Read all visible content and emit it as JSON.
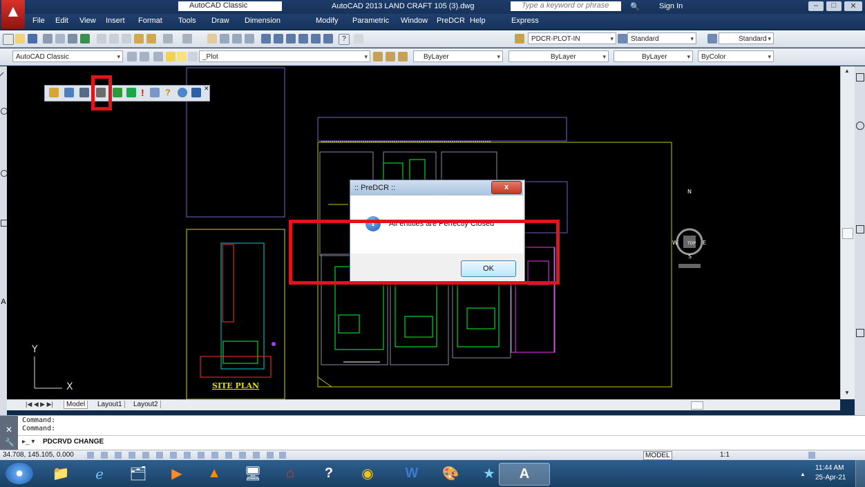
{
  "window": {
    "title": "AutoCAD 2013    LAND CRAFT 105 (3).dwg",
    "workspace": "AutoCAD Classic",
    "search_placeholder": "Type a keyword or phrase",
    "sign_in": "Sign In"
  },
  "menu": [
    "File",
    "Edit",
    "View",
    "Insert",
    "Format",
    "Tools",
    "Draw",
    "Dimension",
    "Modify",
    "Parametric",
    "Window",
    "PreDCR",
    "Help",
    "Express"
  ],
  "toolbars": {
    "plotstyle": "PDCR-PLOT-IN",
    "textstyle": "Standard",
    "dimstyle": "Standard",
    "workspace2": "AutoCAD Classic",
    "layer": "_Plot",
    "color": "ByLayer",
    "linetype": "ByLayer",
    "lineweight": "ByLayer",
    "plotcolor": "ByColor"
  },
  "drawing": {
    "site_plan_label": "SITE PLAN",
    "compass": {
      "n": "N",
      "s": "S",
      "e": "E",
      "w": "W",
      "center": "TOP"
    },
    "axis_x": "X",
    "axis_y": "Y"
  },
  "tabs": {
    "model": "Model",
    "layout1": "Layout1",
    "layout2": "Layout2"
  },
  "dialog": {
    "title": ":: PreDCR ::",
    "message": "All entities are Perfectly Closed",
    "ok": "OK",
    "close": "x"
  },
  "command": {
    "line1": "Command:",
    "line2": "Command:",
    "input": "PDCRVD CHANGE"
  },
  "status": {
    "coords": "34.708, 145.105, 0.000",
    "model": "MODEL",
    "scale": "1:1"
  },
  "taskbar": {
    "time": "11:44 AM",
    "date": "25-Apr-21"
  }
}
